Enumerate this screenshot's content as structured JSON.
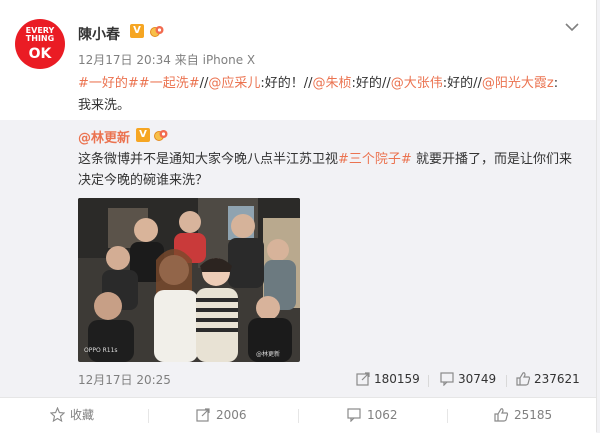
{
  "author": {
    "avatar_lines": [
      "EVERY",
      "THING",
      "OK"
    ],
    "name": "陳小春",
    "verified_badge": "V",
    "time": "12月17日 20:34",
    "source_prefix": "来自",
    "source": "iPhone X"
  },
  "post": {
    "tag1": "#一好的#",
    "tag2": "#一起洗#",
    "sep1": "//",
    "mention1": "@应采儿",
    "text1": ":好的！",
    "sep2": "//",
    "mention2": "@朱桢",
    "text2": ":好的",
    "sep3": "//",
    "mention3": "@大张伟",
    "text3": ":好的",
    "sep4": "//",
    "mention4": "@阳光大霞z",
    "text4": ":",
    "line2": "我来洗。"
  },
  "repost": {
    "user": "@林更新",
    "verified_badge": "V",
    "text_before": "这条微博并不是通知大家今晚八点半江苏卫视",
    "tag": "#三个院子#",
    "text_after": "就要开播了，而是让你们来决定今晚的碗谁来洗？",
    "photo_watermark_left": "OPPO R11s",
    "photo_watermark_right": "@林更新",
    "time": "12月17日 20:25",
    "reposts": "180159",
    "comments": "30749",
    "likes": "237621"
  },
  "actions": {
    "favorite": "收藏",
    "repost": "2006",
    "comment": "1062",
    "like": "25185"
  },
  "colors": {
    "accent": "#eb7350",
    "badge": "#f6a623",
    "avatar_bg": "#ea1c24"
  }
}
